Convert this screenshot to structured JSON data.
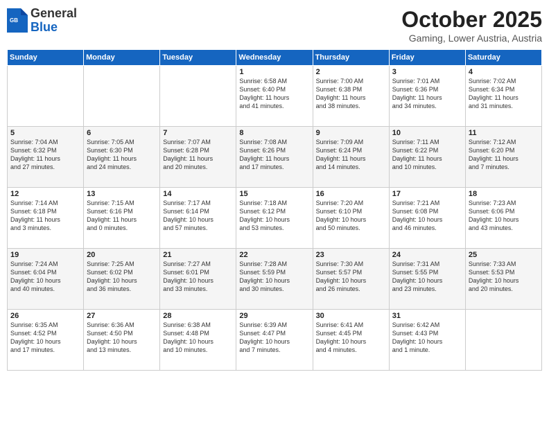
{
  "logo": {
    "general": "General",
    "blue": "Blue"
  },
  "title": "October 2025",
  "location": "Gaming, Lower Austria, Austria",
  "days_header": [
    "Sunday",
    "Monday",
    "Tuesday",
    "Wednesday",
    "Thursday",
    "Friday",
    "Saturday"
  ],
  "weeks": [
    [
      {
        "day": "",
        "info": ""
      },
      {
        "day": "",
        "info": ""
      },
      {
        "day": "",
        "info": ""
      },
      {
        "day": "1",
        "info": "Sunrise: 6:58 AM\nSunset: 6:40 PM\nDaylight: 11 hours\nand 41 minutes."
      },
      {
        "day": "2",
        "info": "Sunrise: 7:00 AM\nSunset: 6:38 PM\nDaylight: 11 hours\nand 38 minutes."
      },
      {
        "day": "3",
        "info": "Sunrise: 7:01 AM\nSunset: 6:36 PM\nDaylight: 11 hours\nand 34 minutes."
      },
      {
        "day": "4",
        "info": "Sunrise: 7:02 AM\nSunset: 6:34 PM\nDaylight: 11 hours\nand 31 minutes."
      }
    ],
    [
      {
        "day": "5",
        "info": "Sunrise: 7:04 AM\nSunset: 6:32 PM\nDaylight: 11 hours\nand 27 minutes."
      },
      {
        "day": "6",
        "info": "Sunrise: 7:05 AM\nSunset: 6:30 PM\nDaylight: 11 hours\nand 24 minutes."
      },
      {
        "day": "7",
        "info": "Sunrise: 7:07 AM\nSunset: 6:28 PM\nDaylight: 11 hours\nand 20 minutes."
      },
      {
        "day": "8",
        "info": "Sunrise: 7:08 AM\nSunset: 6:26 PM\nDaylight: 11 hours\nand 17 minutes."
      },
      {
        "day": "9",
        "info": "Sunrise: 7:09 AM\nSunset: 6:24 PM\nDaylight: 11 hours\nand 14 minutes."
      },
      {
        "day": "10",
        "info": "Sunrise: 7:11 AM\nSunset: 6:22 PM\nDaylight: 11 hours\nand 10 minutes."
      },
      {
        "day": "11",
        "info": "Sunrise: 7:12 AM\nSunset: 6:20 PM\nDaylight: 11 hours\nand 7 minutes."
      }
    ],
    [
      {
        "day": "12",
        "info": "Sunrise: 7:14 AM\nSunset: 6:18 PM\nDaylight: 11 hours\nand 3 minutes."
      },
      {
        "day": "13",
        "info": "Sunrise: 7:15 AM\nSunset: 6:16 PM\nDaylight: 11 hours\nand 0 minutes."
      },
      {
        "day": "14",
        "info": "Sunrise: 7:17 AM\nSunset: 6:14 PM\nDaylight: 10 hours\nand 57 minutes."
      },
      {
        "day": "15",
        "info": "Sunrise: 7:18 AM\nSunset: 6:12 PM\nDaylight: 10 hours\nand 53 minutes."
      },
      {
        "day": "16",
        "info": "Sunrise: 7:20 AM\nSunset: 6:10 PM\nDaylight: 10 hours\nand 50 minutes."
      },
      {
        "day": "17",
        "info": "Sunrise: 7:21 AM\nSunset: 6:08 PM\nDaylight: 10 hours\nand 46 minutes."
      },
      {
        "day": "18",
        "info": "Sunrise: 7:23 AM\nSunset: 6:06 PM\nDaylight: 10 hours\nand 43 minutes."
      }
    ],
    [
      {
        "day": "19",
        "info": "Sunrise: 7:24 AM\nSunset: 6:04 PM\nDaylight: 10 hours\nand 40 minutes."
      },
      {
        "day": "20",
        "info": "Sunrise: 7:25 AM\nSunset: 6:02 PM\nDaylight: 10 hours\nand 36 minutes."
      },
      {
        "day": "21",
        "info": "Sunrise: 7:27 AM\nSunset: 6:01 PM\nDaylight: 10 hours\nand 33 minutes."
      },
      {
        "day": "22",
        "info": "Sunrise: 7:28 AM\nSunset: 5:59 PM\nDaylight: 10 hours\nand 30 minutes."
      },
      {
        "day": "23",
        "info": "Sunrise: 7:30 AM\nSunset: 5:57 PM\nDaylight: 10 hours\nand 26 minutes."
      },
      {
        "day": "24",
        "info": "Sunrise: 7:31 AM\nSunset: 5:55 PM\nDaylight: 10 hours\nand 23 minutes."
      },
      {
        "day": "25",
        "info": "Sunrise: 7:33 AM\nSunset: 5:53 PM\nDaylight: 10 hours\nand 20 minutes."
      }
    ],
    [
      {
        "day": "26",
        "info": "Sunrise: 6:35 AM\nSunset: 4:52 PM\nDaylight: 10 hours\nand 17 minutes."
      },
      {
        "day": "27",
        "info": "Sunrise: 6:36 AM\nSunset: 4:50 PM\nDaylight: 10 hours\nand 13 minutes."
      },
      {
        "day": "28",
        "info": "Sunrise: 6:38 AM\nSunset: 4:48 PM\nDaylight: 10 hours\nand 10 minutes."
      },
      {
        "day": "29",
        "info": "Sunrise: 6:39 AM\nSunset: 4:47 PM\nDaylight: 10 hours\nand 7 minutes."
      },
      {
        "day": "30",
        "info": "Sunrise: 6:41 AM\nSunset: 4:45 PM\nDaylight: 10 hours\nand 4 minutes."
      },
      {
        "day": "31",
        "info": "Sunrise: 6:42 AM\nSunset: 4:43 PM\nDaylight: 10 hours\nand 1 minute."
      },
      {
        "day": "",
        "info": ""
      }
    ]
  ]
}
